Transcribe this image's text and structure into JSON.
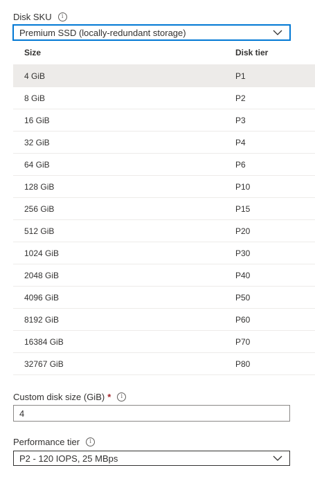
{
  "disk_sku": {
    "label": "Disk SKU",
    "info_glyph": "i",
    "selected": "Premium SSD (locally-redundant storage)"
  },
  "table": {
    "columns": [
      "Size",
      "Disk tier"
    ],
    "selected_row": 0,
    "rows": [
      {
        "size": "4 GiB",
        "tier": "P1"
      },
      {
        "size": "8 GiB",
        "tier": "P2"
      },
      {
        "size": "16 GiB",
        "tier": "P3"
      },
      {
        "size": "32 GiB",
        "tier": "P4"
      },
      {
        "size": "64 GiB",
        "tier": "P6"
      },
      {
        "size": "128 GiB",
        "tier": "P10"
      },
      {
        "size": "256 GiB",
        "tier": "P15"
      },
      {
        "size": "512 GiB",
        "tier": "P20"
      },
      {
        "size": "1024 GiB",
        "tier": "P30"
      },
      {
        "size": "2048 GiB",
        "tier": "P40"
      },
      {
        "size": "4096 GiB",
        "tier": "P50"
      },
      {
        "size": "8192 GiB",
        "tier": "P60"
      },
      {
        "size": "16384 GiB",
        "tier": "P70"
      },
      {
        "size": "32767 GiB",
        "tier": "P80"
      }
    ]
  },
  "custom_size": {
    "label": "Custom disk size (GiB)",
    "required_mark": "*",
    "info_glyph": "i",
    "value": "4"
  },
  "performance_tier": {
    "label": "Performance tier",
    "info_glyph": "i",
    "selected": "P2 - 120 IOPS, 25 MBps"
  },
  "icons": {
    "info": "info-icon",
    "dropdown": "chevron-down-icon"
  },
  "colors": {
    "focus_border": "#0078d4",
    "selected_row": "#edebe9",
    "required": "#a4262c",
    "text": "#323130"
  }
}
